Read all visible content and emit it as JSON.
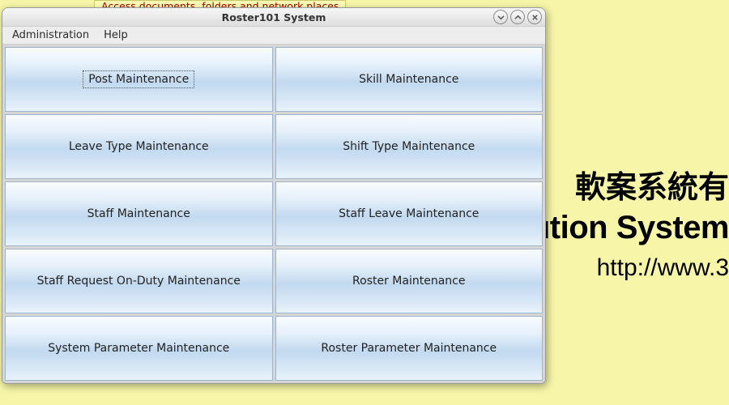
{
  "desktop": {
    "tooltip": "Access documents, folders and network places",
    "brand_line1": "軟案系統有",
    "brand_line2": "t Solution System",
    "brand_line3": "http://www.3"
  },
  "window": {
    "title": "Roster101 System",
    "menu": {
      "administration": "Administration",
      "help": "Help"
    },
    "tiles": [
      {
        "label": "Post Maintenance",
        "focused": true
      },
      {
        "label": "Skill Maintenance",
        "focused": false
      },
      {
        "label": "Leave Type Maintenance",
        "focused": false
      },
      {
        "label": "Shift Type Maintenance",
        "focused": false
      },
      {
        "label": "Staff Maintenance",
        "focused": false
      },
      {
        "label": "Staff Leave Maintenance",
        "focused": false
      },
      {
        "label": "Staff Request On-Duty Maintenance",
        "focused": false
      },
      {
        "label": "Roster Maintenance",
        "focused": false
      },
      {
        "label": "System Parameter Maintenance",
        "focused": false
      },
      {
        "label": "Roster Parameter Maintenance",
        "focused": false
      }
    ]
  }
}
